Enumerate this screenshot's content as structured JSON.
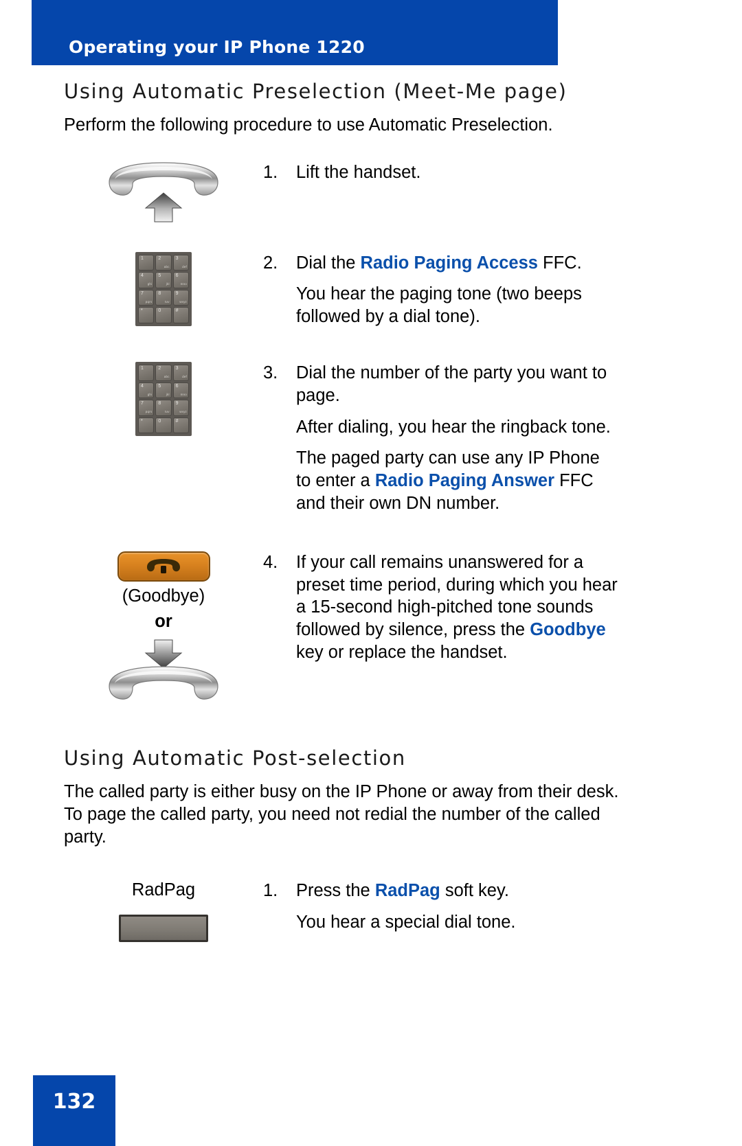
{
  "header": {
    "title": "Operating your IP Phone 1220",
    "bar_color": "#0546ab"
  },
  "sections": [
    {
      "heading": "Using Automatic Preselection (Meet-Me page)",
      "intro": "Perform the following procedure to use Automatic Preselection."
    },
    {
      "heading": "Using Automatic Post-selection",
      "intro_line_1": "The called party is either busy on the IP Phone or away from their desk.",
      "intro_line_2": "To page the called party, you need not redial the number of the called",
      "intro_line_3": "party."
    }
  ],
  "preselection_steps": [
    {
      "number": "1.",
      "icon": "handset-lift-icon",
      "paragraphs": [
        {
          "pre": "Lift the handset.",
          "em": "",
          "post": ""
        }
      ]
    },
    {
      "number": "2.",
      "icon": "dialpad-icon",
      "paragraphs": [
        {
          "pre": "Dial the ",
          "em": "Radio Paging Access",
          "post": " FFC."
        },
        {
          "pre": "You hear the paging tone (two beeps followed by a dial tone).",
          "em": "",
          "post": ""
        }
      ]
    },
    {
      "number": "3.",
      "icon": "dialpad-icon",
      "paragraphs": [
        {
          "pre": "Dial the number of the party you want to page.",
          "em": "",
          "post": ""
        },
        {
          "pre": "After dialing, you hear the ringback tone.",
          "em": "",
          "post": ""
        },
        {
          "pre": "The paged party can use any IP Phone to enter a ",
          "em": "Radio Paging Answer",
          "post": " FFC and their own DN number."
        }
      ]
    },
    {
      "number": "4.",
      "icon": "goodbye-key-icon",
      "caption": "(Goodbye)",
      "caption_or": "or",
      "icon_alt": "handset-replace-icon",
      "paragraphs": [
        {
          "pre": "If your call remains unanswered for a preset time period, during which you hear a 15-second high-pitched tone sounds followed by silence, press the ",
          "em": "Goodbye",
          "post": " key or replace the handset."
        }
      ]
    }
  ],
  "postselection_steps": [
    {
      "number": "1.",
      "softkey_label": "RadPag",
      "icon": "softkey-button-icon",
      "paragraphs": [
        {
          "pre": "Press the ",
          "em": "RadPag",
          "post": " soft key."
        },
        {
          "pre": "You hear a special dial tone.",
          "em": "",
          "post": ""
        }
      ]
    }
  ],
  "keypad": {
    "keys": [
      {
        "digit": "1",
        "letters": ""
      },
      {
        "digit": "2",
        "letters": "abc"
      },
      {
        "digit": "3",
        "letters": "def"
      },
      {
        "digit": "4",
        "letters": "ghi"
      },
      {
        "digit": "5",
        "letters": "jkl"
      },
      {
        "digit": "6",
        "letters": "mno"
      },
      {
        "digit": "7",
        "letters": "pqrs"
      },
      {
        "digit": "8",
        "letters": "tuv"
      },
      {
        "digit": "9",
        "letters": "wxyz"
      },
      {
        "digit": "*",
        "letters": ""
      },
      {
        "digit": "0",
        "letters": ""
      },
      {
        "digit": "#",
        "letters": ""
      }
    ]
  },
  "footer": {
    "page_number": "132"
  },
  "colors": {
    "brand_blue": "#0546ab",
    "emphasis_blue": "#0b50ab",
    "goodbye_orange": "#d8821f"
  }
}
